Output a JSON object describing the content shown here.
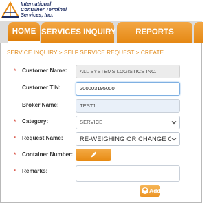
{
  "logo": {
    "lines": [
      "International",
      "Container Terminal",
      "Services, Inc."
    ]
  },
  "nav": {
    "tabs": [
      {
        "label": "HOME"
      },
      {
        "label": "SERVICES INQUIRY"
      },
      {
        "label": "REPORTS"
      }
    ]
  },
  "breadcrumb": "SERVICE INQUIRY > SELF SERVICE REQUEST > CREATE",
  "form": {
    "customer_name": {
      "label": "Customer Name:",
      "value": "ALL SYSTEMS LOGISTICS INC.",
      "required": "*"
    },
    "customer_tin": {
      "label": "Customer TIN:",
      "value": "200003195000"
    },
    "broker_name": {
      "label": "Broker Name:",
      "value": "TEST1"
    },
    "category": {
      "label": "Category:",
      "value": "SERVICE",
      "required": "*"
    },
    "request_name": {
      "label": "Request Name:",
      "value": "RE-WEIGHING OR CHANGE OF",
      "required": "*"
    },
    "container_number": {
      "label": "Container Number:",
      "required": "*"
    },
    "remarks": {
      "label": "Remarks:",
      "value": "",
      "required": "*"
    }
  },
  "add_button": {
    "label": "Add"
  },
  "colors": {
    "accent": "#e98c17",
    "breadcrumb": "#e08a1a",
    "required": "#d33a2b",
    "field_bg": "#e9f0f9"
  },
  "icons": {
    "logo": "ictsi-logo-icon",
    "select": "chevron-down-icon",
    "edit": "pencil-icon",
    "add": "plus-icon"
  }
}
